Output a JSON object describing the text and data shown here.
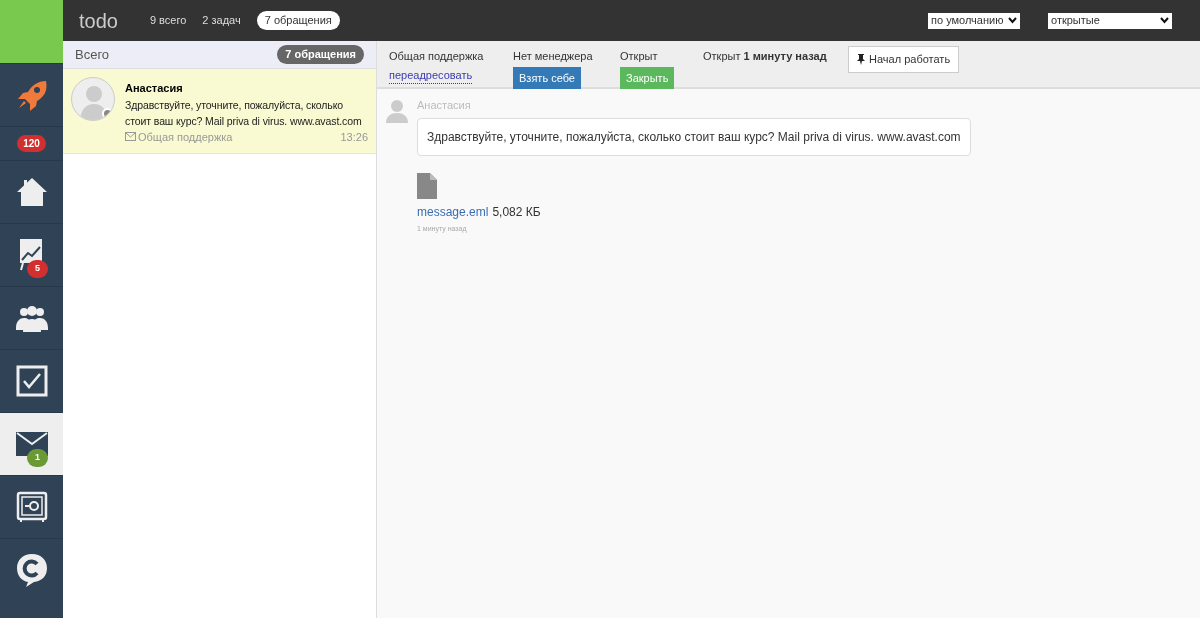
{
  "topbar": {
    "title": "todo",
    "tabs": [
      {
        "label": "9 всего",
        "selected": false
      },
      {
        "label": "2 задач",
        "selected": false
      },
      {
        "label": "7 обращения",
        "selected": true
      }
    ],
    "selects": [
      {
        "value": "по умолчанию"
      },
      {
        "value": "открытые"
      }
    ]
  },
  "sidebar": {
    "items": [
      {
        "kind": "rocket",
        "selected": false
      },
      {
        "kind": "counter",
        "badge": "120",
        "color": "#d32f2f"
      },
      {
        "kind": "home",
        "selected": false
      },
      {
        "kind": "chart",
        "selected": false,
        "badge": "5",
        "color": "#d32f2f"
      },
      {
        "kind": "users",
        "selected": false
      },
      {
        "kind": "tasks",
        "selected": false
      },
      {
        "kind": "mail",
        "selected": true,
        "badge": "1",
        "color": "#6a9a34"
      },
      {
        "kind": "safe",
        "selected": false
      },
      {
        "kind": "chat",
        "selected": false
      }
    ]
  },
  "list": {
    "title": "Всего",
    "count": "7 обращения",
    "items": [
      {
        "name": "Анастасия",
        "text": "Здравствуйте, уточните, пожалуйста, сколько стоит ваш курс? Mail priva di virus. www.avast.com",
        "channel": "Общая поддержка",
        "time": "13:26",
        "selected": true
      }
    ]
  },
  "toolbar": {
    "group": "Общая поддержка",
    "forward": "переадресовать",
    "manager": "Нет менеджера",
    "take": "Взять себе",
    "status": "Открыт",
    "close": "Закрыть",
    "opened": "Открыт **1 минуту назад**",
    "start": "Начал работать"
  },
  "messages": [
    {
      "author": "Анастасия",
      "text": "Здравствуйте, уточните, пожалуйста, сколько стоит ваш курс? Mail priva di virus. www.avast.com",
      "attachment": "message.eml",
      "size": "5,082 КБ",
      "time": "1 минуту назад"
    }
  ]
}
